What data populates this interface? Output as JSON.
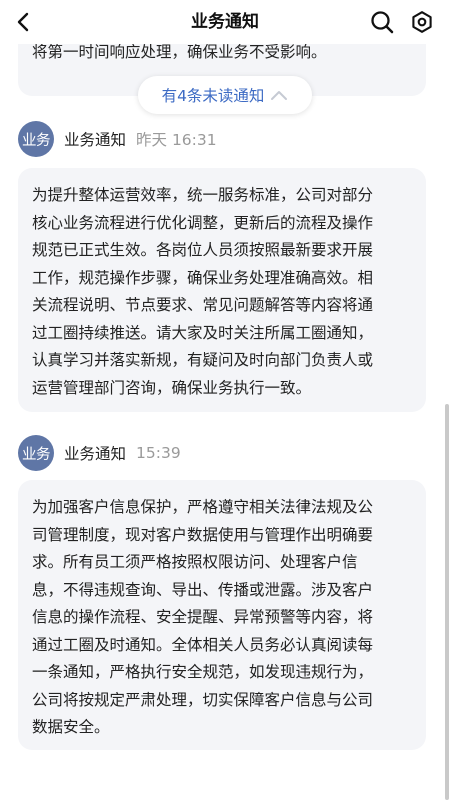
{
  "header": {
    "title": "业务通知"
  },
  "unread": {
    "label": "有4条未读通知"
  },
  "messages": [
    {
      "partial_text": "将第一时间响应处理，确保业务不受影响。"
    },
    {
      "avatar_text": "业务",
      "sender": "业务通知",
      "time": "昨天 16:31",
      "lines": [
        "为提升整体运营效率，统一服务标准，公司对部分",
        "核心业务流程进行优化调整，更新后的流程及操作",
        "规范已正式生效。各岗位人员须按照最新要求开展",
        "工作，规范操作步骤，确保业务处理准确高效。相",
        "关流程说明、节点要求、常见问题解答等内容将通",
        "过工圈持续推送。请大家及时关注所属工圈通知，",
        "认真学习并落实新规，有疑问及时向部门负责人或",
        "运营管理部门咨询，确保业务执行一致。"
      ]
    },
    {
      "avatar_text": "业务",
      "sender": "业务通知",
      "time": "15:39",
      "lines": [
        "为加强客户信息保护，严格遵守相关法律法规及公",
        "司管理制度，现对客户数据使用与管理作出明确要",
        "求。所有员工须严格按照权限访问、处理客户信",
        "息，不得违规查询、导出、传播或泄露。涉及客户",
        "信息的操作流程、安全提醒、异常预警等内容，将",
        "通过工圈及时通知。全体相关人员务必认真阅读每",
        "一条通知，严格执行安全规范，如发现违规行为，",
        "公司将按规定严肃处理，切实保障客户信息与公司",
        "数据安全。"
      ]
    }
  ],
  "colors": {
    "avatar_bg": "#5f76a6",
    "bubble_bg": "#f4f5f8",
    "unread_text": "#3d6bc4",
    "time_text": "#9a9a9a"
  },
  "icons": [
    "back-arrow-icon",
    "search-icon",
    "settings-icon",
    "chevron-up-icon"
  ]
}
